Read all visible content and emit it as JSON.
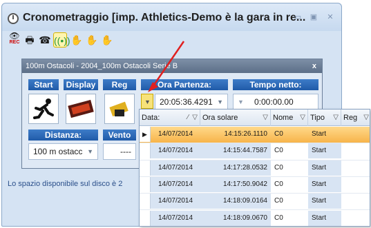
{
  "window": {
    "title": "Cronometraggio [imp. Athletics-Demo è la gara in re..."
  },
  "toolbar": {
    "rec_label": "REC"
  },
  "dialog": {
    "title": "100m Ostacoli - 2004_100m Ostacoli Serie B",
    "close": "x",
    "start_label": "Start",
    "display_label": "Display",
    "reg_label": "Reg",
    "ora_partenza_label": "Ora Partenza:",
    "ora_partenza_value": "20:05:36.4291",
    "tempo_netto_label": "Tempo netto:",
    "tempo_netto_value": "0:00:00.00",
    "distanza_label": "Distanza:",
    "distanza_value": "100 m ostacc",
    "vento_label": "Vento",
    "vento_value": "----"
  },
  "status": {
    "text": "Lo spazio disponibile sul disco è 2"
  },
  "grid": {
    "columns": [
      "Data:",
      "Ora solare",
      "Nome",
      "Tipo",
      "Reg"
    ],
    "rows": [
      {
        "date": "14/07/2014",
        "time": "14:15:26.1110",
        "name": "C0",
        "type": "Start"
      },
      {
        "date": "14/07/2014",
        "time": "14:15:44.7587",
        "name": "C0",
        "type": "Start"
      },
      {
        "date": "14/07/2014",
        "time": "14:17:28.0532",
        "name": "C0",
        "type": "Start"
      },
      {
        "date": "14/07/2014",
        "time": "14:17:50.9042",
        "name": "C0",
        "type": "Start"
      },
      {
        "date": "14/07/2014",
        "time": "14:18:09.0164",
        "name": "C0",
        "type": "Start"
      },
      {
        "date": "14/07/2014",
        "time": "14:18:09.0670",
        "name": "C0",
        "type": "Start"
      }
    ]
  }
}
